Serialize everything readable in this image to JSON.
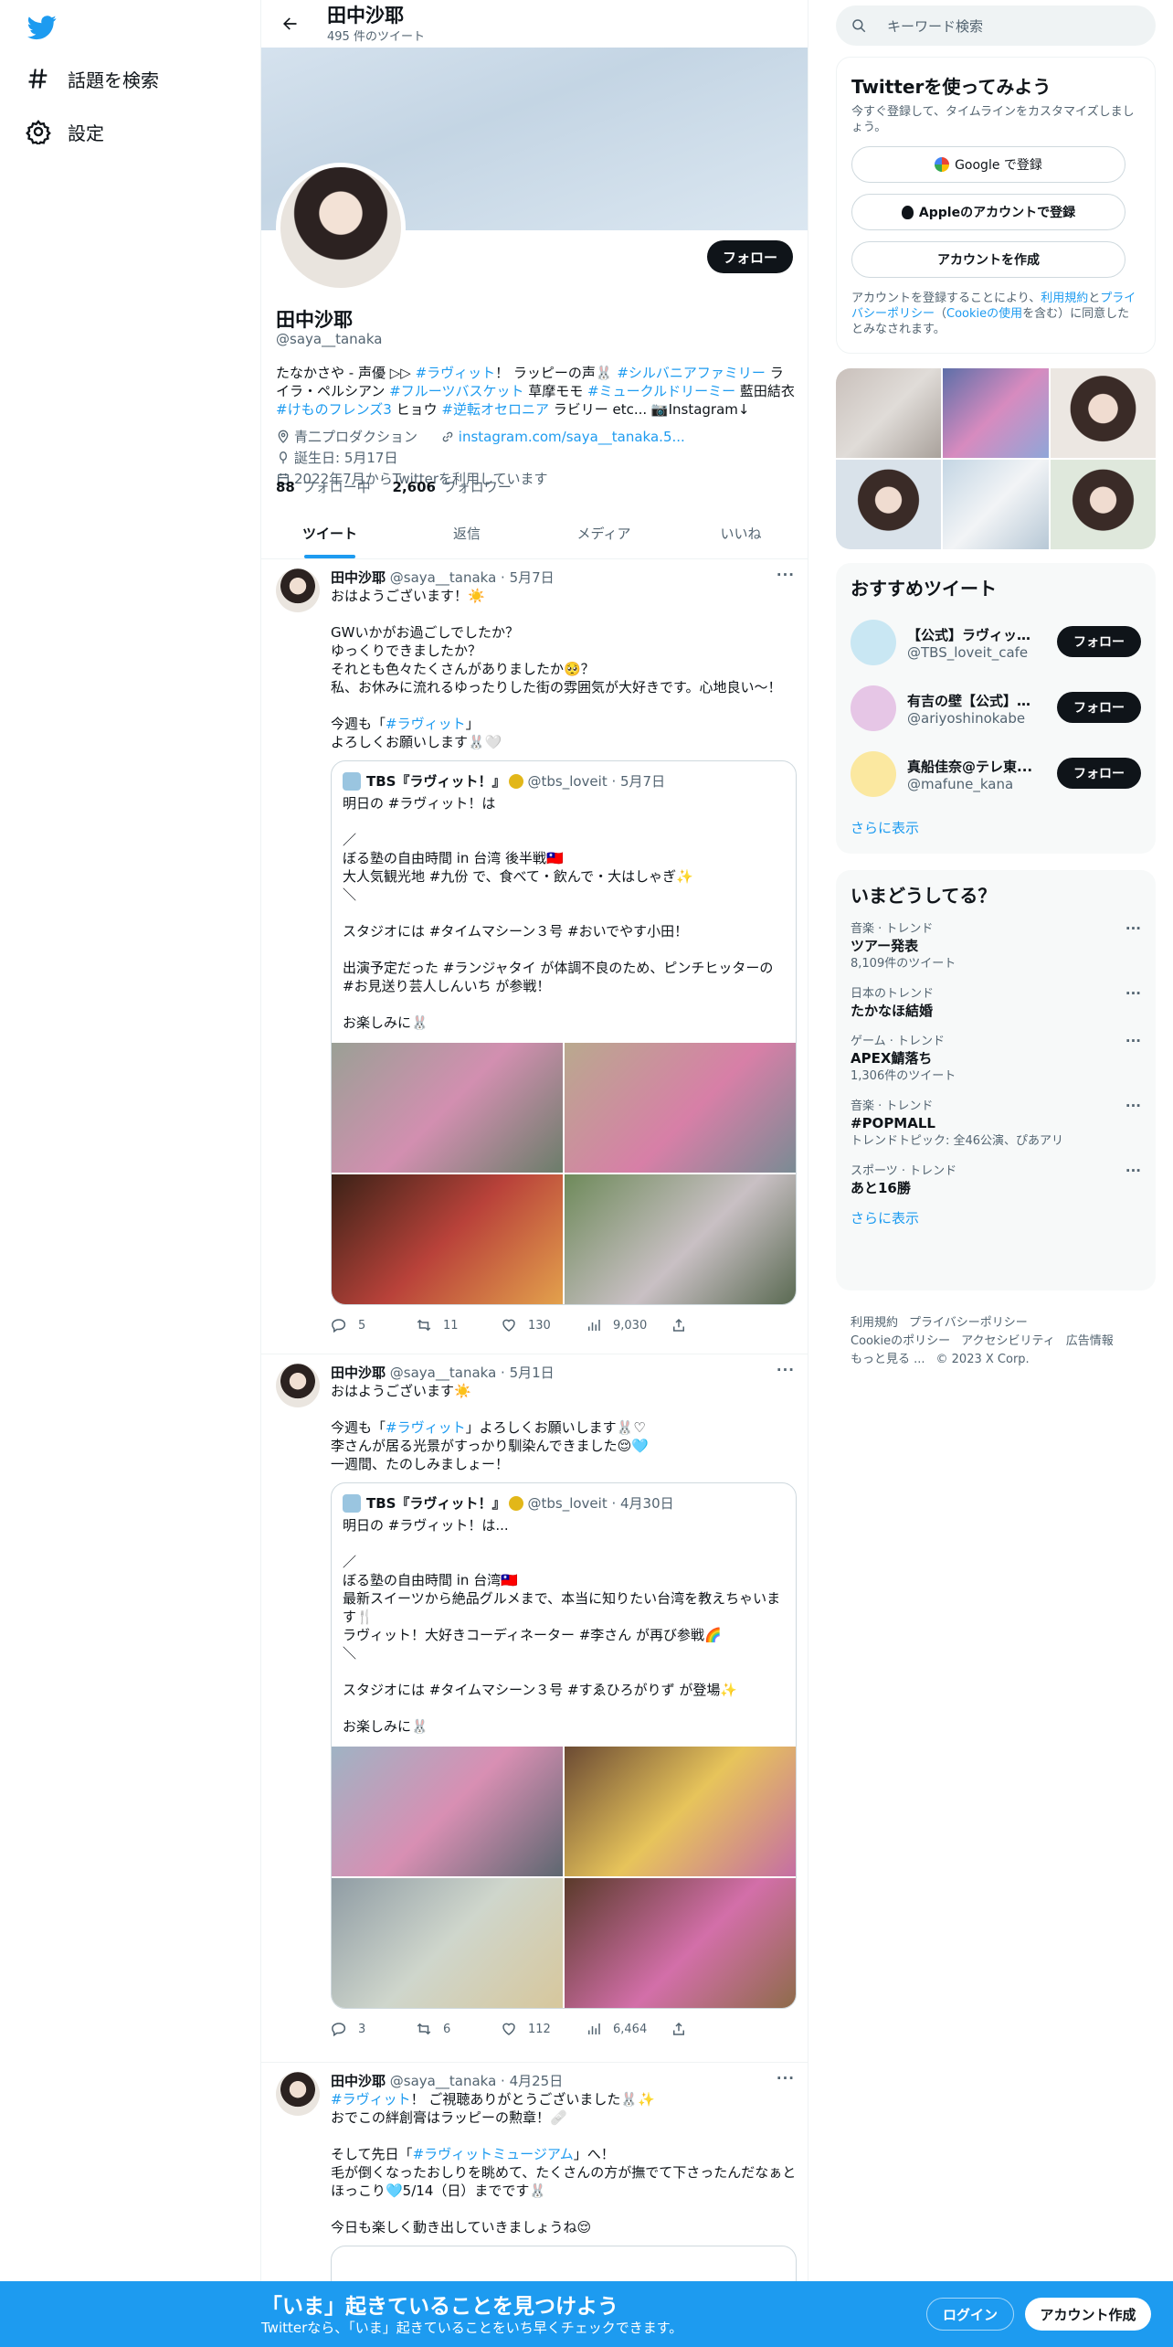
{
  "nav": {
    "explore_label": "話題を検索",
    "settings_label": "設定"
  },
  "header": {
    "title": "田中沙耶",
    "tweet_count": "495 件のツイート"
  },
  "profile": {
    "name": "田中沙耶",
    "handle": "@saya__tanaka",
    "follow_label": "フォロー",
    "bio": [
      {
        "t": "たなかさや - 声優 ▷▷ ",
        "c": ""
      },
      {
        "t": "#ラヴィット",
        "c": "blue"
      },
      {
        "t": "！ ラッピーの声🐰 ",
        "c": ""
      },
      {
        "t": "#シルバニアファミリー",
        "c": "blue"
      },
      {
        "t": " ライラ・ペルシアン ",
        "c": ""
      },
      {
        "t": "#フルーツバスケット",
        "c": "blue"
      },
      {
        "t": " 草摩モモ ",
        "c": ""
      },
      {
        "t": "#ミュークルドリーミー",
        "c": "blue"
      },
      {
        "t": " 藍田結衣 ",
        "c": ""
      },
      {
        "t": "#けものフレンズ3",
        "c": "blue"
      },
      {
        "t": " ヒョウ ",
        "c": ""
      },
      {
        "t": "#逆転オセロニア",
        "c": "blue"
      },
      {
        "t": " ラビリー etc... 📷Instagram↓",
        "c": ""
      }
    ],
    "agency": "青二プロダクション",
    "link": "instagram.com/saya__tanaka.5...",
    "birthday": "誕生日: 5月17日",
    "joined": "2022年7月からTwitterを利用しています",
    "following_count": "88",
    "following_label": "フォロー中",
    "followers_count": "2,606",
    "followers_label": "フォロワー"
  },
  "tabs": [
    "ツイート",
    "返信",
    "メディア",
    "いいね"
  ],
  "tweets": [
    {
      "name": "田中沙耶",
      "handle": "@saya__tanaka",
      "date": "5月7日",
      "text_before": "おはようございます！☀️\n\nGWいかがお過ごしでしたか？\nゆっくりできましたか？\nそれとも色々たくさんがありましたか🥺？\n私、お休みに流れるゆったりした街の雰囲気が大好きです。心地良い〜！\n\n今週も「",
      "text_link": "#ラヴィット",
      "text_after": "」\nよろしくお願いします🐰🤍",
      "quote": {
        "name": "TBS『ラヴィット！』",
        "handle": "@tbs_loveit",
        "date": "5月7日",
        "text": "明日の #ラヴィット！は\n\n／\nぼる塾の自由時間 in 台湾 後半戦🇹🇼\n大人気観光地 #九份 で、食べて・飲んで・大はしゃぎ✨\n＼\n\nスタジオには #タイムマシーン３号 #おいでやす小田！\n\n出演予定だった #ランジャタイ が体調不良のため、ピンチヒッターの #お見送り芸人しんいち が参戦！\n\nお楽しみに🐰"
      },
      "replies": "5",
      "retweets": "11",
      "likes": "130",
      "views": "9,030"
    },
    {
      "name": "田中沙耶",
      "handle": "@saya__tanaka",
      "date": "5月1日",
      "text_before": "おはようございます☀️\n\n今週も「",
      "text_link": "#ラヴィット",
      "text_after": "」よろしくお願いします🐰♡\n李さんが居る光景がすっかり馴染んできました😌🩵\n一週間、たのしみましょー！",
      "quote": {
        "name": "TBS『ラヴィット！』",
        "handle": "@tbs_loveit",
        "date": "4月30日",
        "text": "明日の #ラヴィット！は...\n\n／\nぼる塾の自由時間 in 台湾🇹🇼\n最新スイーツから絶品グルメまで、本当に知りたい台湾を教えちゃいます🍴\nラヴィット！大好きコーディネーター #李さん が再び参戦🌈\n＼\n\nスタジオには #タイムマシーン３号 #すゑひろがりず が登場✨\n\nお楽しみに🐰"
      },
      "replies": "3",
      "retweets": "6",
      "likes": "112",
      "views": "6,464"
    },
    {
      "name": "田中沙耶",
      "handle": "@saya__tanaka",
      "date": "4月25日",
      "text_link": "#ラヴィット",
      "text_after": "！ ご視聴ありがとうございました🐰✨\nおでこの絆創膏はラッピーの勲章！🩹\n\nそして先日「",
      "text_link2": "#ラヴィットミュージアム",
      "text_after2": "」へ！\n毛が倒くなったおしりを眺めて、たくさんの方が撫でて下さったんだなぁとほっこり🩵5/14（日）までです🐰\n\n今日も楽しく動き出していきましょうね😌"
    }
  ],
  "right": {
    "search_placeholder": "キーワード検索",
    "signup": {
      "title": "Twitterを使ってみよう",
      "sub": "今すぐ登録して、タイムラインをカスタマイズしましょう。",
      "google": "Google で登録",
      "apple": "Appleのアカウントで登録",
      "create": "アカウントを作成",
      "legal_1": "アカウントを登録することにより、",
      "legal_terms": "利用規約",
      "legal_2": "と",
      "legal_privacy": "プライバシーポリシー",
      "legal_3": "（",
      "legal_cookie": "Cookieの使用",
      "legal_4": "を含む）に同意したとみなされます。"
    },
    "recs_title": "おすすめツイート",
    "recs": [
      {
        "name": "【公式】ラヴィット...",
        "handle": "@TBS_loveit_cafe",
        "color": "#c9e7f3"
      },
      {
        "name": "有吉の壁【公式】毎...",
        "handle": "@ariyoshinokabe",
        "color": "#e6c6e6"
      },
      {
        "name": "真船佳奈@テレ東...",
        "handle": "@mafune_kana",
        "color": "#fbe8a0"
      }
    ],
    "rec_follow": "フォロー",
    "show_more": "さらに表示",
    "trends_title": "いまどうしてる？",
    "trends": [
      {
        "cat": "音楽 · トレンド",
        "name": "ツアー発表",
        "cnt": "8,109件のツイート"
      },
      {
        "cat": "日本のトレンド",
        "name": "たかなほ結婚",
        "cnt": ""
      },
      {
        "cat": "ゲーム · トレンド",
        "name": "APEX鯖落ち",
        "cnt": "1,306件のツイート"
      },
      {
        "cat": "音楽 · トレンド",
        "name": "#POPMALL",
        "cnt": "トレンドトピック: 全46公演、ぴあアリ"
      },
      {
        "cat": "スポーツ · トレンド",
        "name": "あと16勝",
        "cnt": ""
      }
    ],
    "footer": [
      "利用規約",
      "プライバシーポリシー",
      "Cookieのポリシー",
      "アクセシビリティ",
      "広告情報",
      "もっと見る ...",
      "© 2023 X Corp."
    ]
  },
  "bottom": {
    "title": "「いま」起きていることを見つけよう",
    "sub": "Twitterなら、「いま」起きていることをいち早くチェックできます。",
    "login": "ログイン",
    "signup": "アカウント作成"
  },
  "colors": {
    "accent": "#1d9bf0",
    "dark_button": "#0f1419",
    "muted_text": "#536471"
  }
}
